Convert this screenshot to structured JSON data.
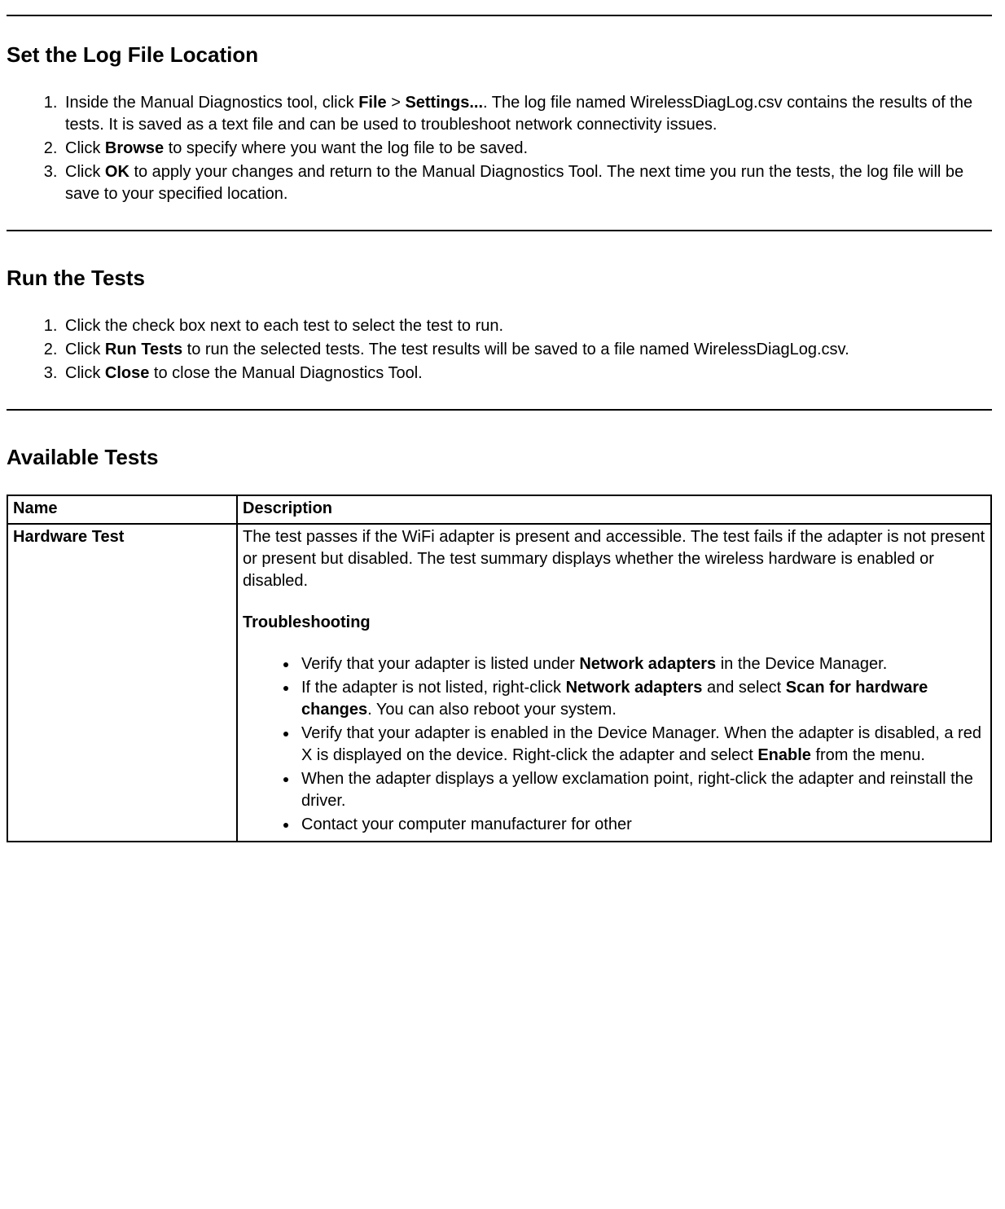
{
  "section1": {
    "heading": "Set the Log File Location",
    "items": [
      {
        "pre1": "Inside the Manual Diagnostics tool, click ",
        "b1": "File",
        "mid1": " > ",
        "b2": "Settings...",
        "post1": ". The log file named WirelessDiagLog.csv contains the results of the tests. It is saved as a text file and can be used to troubleshoot network connectivity issues."
      },
      {
        "pre1": "Click ",
        "b1": "Browse",
        "post1": " to specify where you want the log file to be saved."
      },
      {
        "pre1": "Click ",
        "b1": "OK",
        "post1": " to apply your changes and return to the Manual Diagnostics Tool. The next time you run the tests, the log file will be save to your specified location."
      }
    ]
  },
  "section2": {
    "heading": "Run the Tests",
    "items": [
      {
        "text": "Click the check box next to each test to select the test to run."
      },
      {
        "pre1": "Click ",
        "b1": "Run Tests",
        "post1": " to run the selected tests. The test results will be saved to a file named WirelessDiagLog.csv."
      },
      {
        "pre1": "Click ",
        "b1": "Close",
        "post1": " to close the Manual Diagnostics Tool."
      }
    ]
  },
  "section3": {
    "heading": "Available Tests",
    "table": {
      "headers": {
        "name": "Name",
        "desc": "Description"
      },
      "row1": {
        "name": "Hardware Test",
        "desc_para": "The test passes if the WiFi adapter is present and accessible. The test fails if the adapter is not present or present but disabled. The test summary displays whether the wireless hardware is enabled or disabled.",
        "ts_title": "Troubleshooting",
        "bullets": [
          {
            "pre1": "Verify that your adapter is listed under ",
            "b1": "Network adapters",
            "post1": " in the Device Manager."
          },
          {
            "pre1": "If the adapter is not listed, right-click ",
            "b1": "Network adapters",
            "mid1": " and select ",
            "b2": "Scan for hardware changes",
            "post1": ". You can also reboot your system."
          },
          {
            "pre1": "Verify that your adapter is enabled in the Device Manager. When the adapter is disabled, a red X is displayed on the device. Right-click the adapter and select ",
            "b1": "Enable",
            "post1": " from the menu."
          },
          {
            "pre1": "When the adapter displays a yellow exclamation point, right-click the adapter and reinstall the driver."
          },
          {
            "pre1": "Contact your computer manufacturer for other"
          }
        ]
      }
    }
  }
}
